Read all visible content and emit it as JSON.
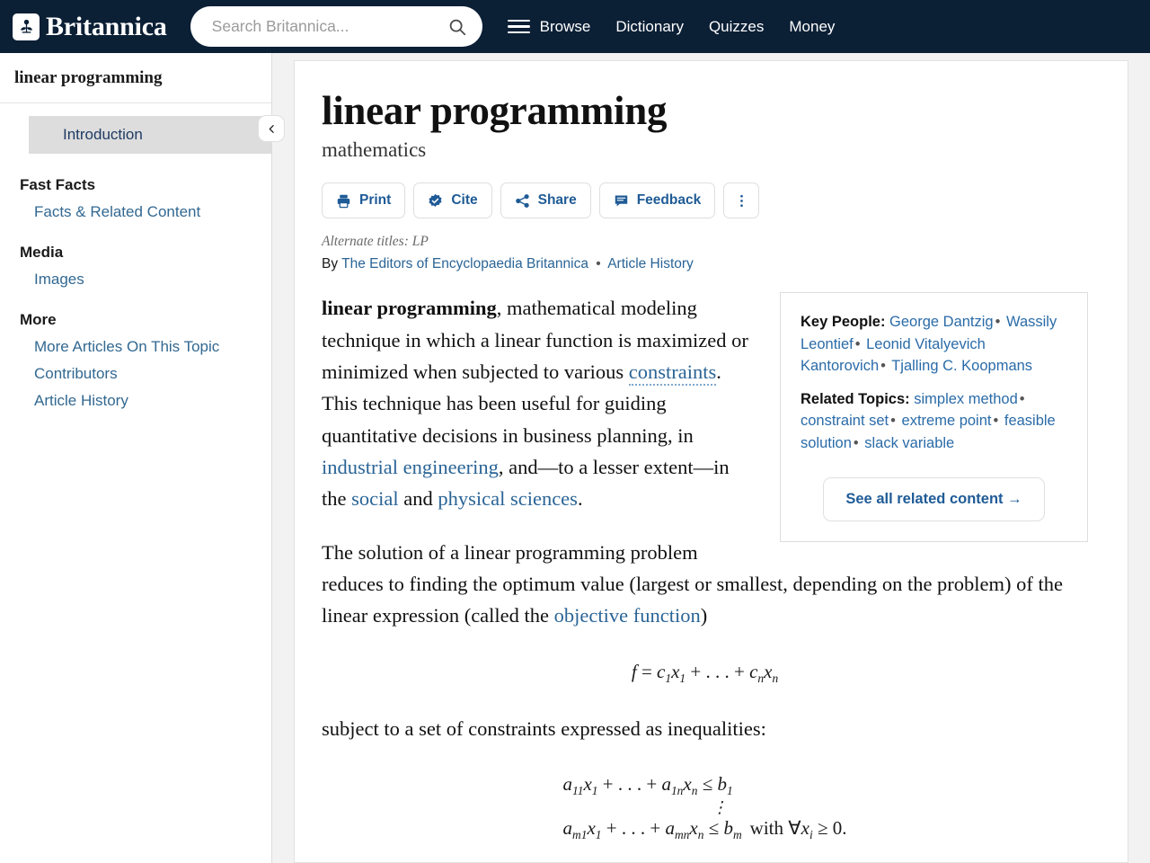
{
  "header": {
    "brand_name": "Britannica",
    "brand_icon": "thistle-logo-icon",
    "search": {
      "placeholder": "Search Britannica...",
      "value": "",
      "icon": "search-icon"
    },
    "nav": [
      {
        "label": "Browse",
        "icon": "hamburger-menu-icon"
      },
      {
        "label": "Dictionary"
      },
      {
        "label": "Quizzes"
      },
      {
        "label": "Money"
      }
    ],
    "background_color": "#0b1f35"
  },
  "sidebar": {
    "title": "linear programming",
    "collapse_icon": "chevron-left-icon",
    "current_item": "Introduction",
    "groups": [
      {
        "title": "Fast Facts",
        "links": [
          "Facts & Related Content"
        ]
      },
      {
        "title": "Media",
        "links": [
          "Images"
        ]
      },
      {
        "title": "More",
        "links": [
          "More Articles On This Topic",
          "Contributors",
          "Article History"
        ]
      }
    ]
  },
  "article": {
    "title": "linear programming",
    "subtitle": "mathematics",
    "actions": [
      {
        "label": "Print",
        "icon": "printer-icon"
      },
      {
        "label": "Cite",
        "icon": "badge-check-icon"
      },
      {
        "label": "Share",
        "icon": "share-nodes-icon"
      },
      {
        "label": "Feedback",
        "icon": "comment-icon"
      },
      {
        "label": "",
        "icon": "vertical-ellipsis-icon"
      }
    ],
    "alternate_titles": "Alternate titles: LP",
    "byline_prefix": "By",
    "byline_author": "The Editors of Encyclopaedia Britannica",
    "byline_separator": "•",
    "byline_history": "Article History",
    "paragraph1": {
      "lead": "linear programming",
      "t1": ", mathematical modeling technique in which a linear function is maximized or minimized when subjected to various ",
      "link1": "constraints",
      "t2": ". This technique has been useful for guiding quantitative decisions in business planning, in ",
      "link2": "industrial engineering",
      "t3": ", and—to a lesser extent—in the ",
      "link3": "social",
      "t4": " and ",
      "link4": "physical sciences",
      "t5": "."
    },
    "paragraph2": {
      "t1": "The solution of a linear programming problem reduces to finding the optimum value (largest or smallest, depending on the problem) of the linear expression (called the ",
      "link1": "objective function",
      "t2": ")"
    },
    "formula1": {
      "lhs": "f",
      "eq": "=",
      "term1_coef": "c",
      "term1_coef_sub": "1",
      "term1_var": "x",
      "term1_var_sub": "1",
      "ellipsis": "+ . . . +",
      "term2_coef": "c",
      "term2_coef_sub": "n",
      "term2_var": "x",
      "term2_var_sub": "n"
    },
    "paragraph3": "subject to a set of constraints expressed as inequalities:",
    "formula2": {
      "row1": {
        "a": "a",
        "a_sub": "11",
        "x": "x",
        "x_sub": "1",
        "ellipsis": "+ . . . +",
        "a2": "a",
        "a2_sub": "1n",
        "x2": "x",
        "x2_sub": "n",
        "rel": "≤",
        "b": "b",
        "b_sub": "1"
      },
      "vdots": "⋮",
      "row2": {
        "a": "a",
        "a_sub": "m1",
        "x": "x",
        "x_sub": "1",
        "ellipsis": "+ . . . +",
        "a2": "a",
        "a2_sub": "mn",
        "x2": "x",
        "x2_sub": "n",
        "rel": "≤",
        "b": "b",
        "b_sub": "m",
        "with": "with",
        "forall": "∀",
        "fvar": "x",
        "fvar_sub": "i",
        "frel": "≥",
        "fval": "0."
      }
    }
  },
  "infobox": {
    "key_people_label": "Key People:",
    "key_people": [
      "George Dantzig",
      "Wassily Leontief",
      "Leonid Vitalyevich Kantorovich",
      "Tjalling C. Koopmans"
    ],
    "related_topics_label": "Related Topics:",
    "related_topics": [
      "simplex method",
      "constraint set",
      "extreme point",
      "feasible solution",
      "slack variable"
    ],
    "see_all_label": "See all related content →",
    "separator": "•"
  },
  "colors": {
    "header_navy": "#0b1f35",
    "link_blue": "#2a6496",
    "accent_blue": "#1f5b96",
    "highlight_gray": "#dddddd",
    "page_bg": "#f2f2f2"
  }
}
